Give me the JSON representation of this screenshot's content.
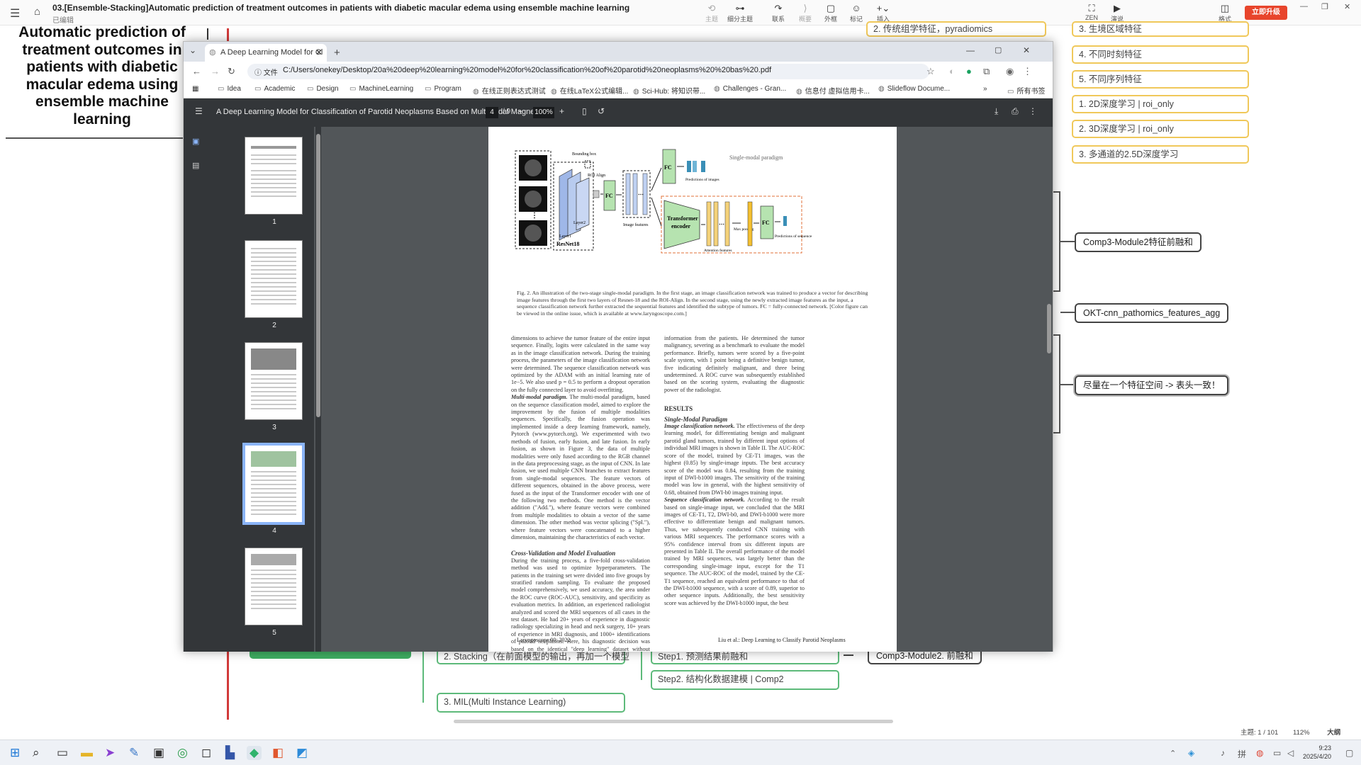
{
  "app": {
    "title": "03.[Ensemble-Stacking]Automatic prediction of treatment outcomes in patients with diabetic macular edema using ensemble machine learning",
    "subtitle": "已编辑",
    "tools": [
      {
        "icon": "theme-icon",
        "label": "主题",
        "dim": true
      },
      {
        "icon": "subtopic-icon",
        "label": "细分主题",
        "dim": false
      },
      {
        "icon": "relation-icon",
        "label": "联系",
        "dim": false
      },
      {
        "icon": "summary-icon",
        "label": "概要",
        "dim": true
      },
      {
        "icon": "boundary-icon",
        "label": "外框",
        "dim": false
      },
      {
        "icon": "marker-icon",
        "label": "标记",
        "dim": false
      },
      {
        "icon": "insert-icon",
        "label": "插入",
        "dim": false
      }
    ],
    "zen_label": "ZEN",
    "present_label": "演说",
    "format_label": "格式",
    "upgrade_label": "立即升级"
  },
  "mindmap": {
    "central_topic": "Automatic prediction of treatment outcomes in patients with diabetic macular edema using ensemble machine learning",
    "right_nodes_yellow": [
      "2. 传统组学特征，pyradiomics",
      "3. 生境区域特征",
      "4. 不同时刻特征",
      "5. 不同序列特征",
      "1. 2D深度学习 | roi_only",
      "2. 3D深度学习 | roi_only",
      "3. 多通道的2.5D深度学习"
    ],
    "right_nodes_dark": [
      "Comp3-Module2特征前融和",
      "OKT-cnn_pathomics_features_agg",
      "尽量在一个特征空间 -> 表头一致！"
    ],
    "bottom_nodes": [
      "2. Stacking（在前面模型的输出，再加一个模型",
      "3. MIL(Multi Instance Learning)",
      "Step1. 预测结果前融和",
      "Step2. 结构化数据建模 | Comp2",
      "Comp3-Module2. 前融和"
    ]
  },
  "browser": {
    "tab_title": "A Deep Learning Model for Cl",
    "url_info": "文件",
    "url": "C:/Users/onekey/Desktop/20a%20deep%20learning%20model%20for%20classification%20of%20parotid%20neoplasms%20%20bas%20.pdf",
    "bookmarks": [
      "Idea",
      "Academic",
      "Design",
      "MachineLearning",
      "Program",
      "在线正则表达式测试",
      "在线LaTeX公式编辑...",
      "Sci-Hub: 将知识带...",
      "Challenges - Gran...",
      "信息付 虚拟信用卡...",
      "Slideflow Docume..."
    ],
    "bookmarks_more": "»",
    "all_bookmarks": "所有书签"
  },
  "pdf": {
    "title": "A Deep Learning Model for Classification of Parotid Neoplasms Based on Multimodal Magne...",
    "current_page": "4",
    "total_pages": "/ 9",
    "zoom": "100%",
    "thumbnails": [
      "1",
      "2",
      "3",
      "4",
      "5"
    ],
    "selected_thumbnail": 3,
    "figure": {
      "bounding_box": "Bounding box",
      "roi_align": "ROI Align",
      "layer1": "Layer1",
      "layer2": "Layer2",
      "resnet": "ResNet18",
      "fc": "FC",
      "image_features": "Image features",
      "predictions_images": "Predictions of images",
      "single_modal": "Single-modal paradigm",
      "transformer": "Transformer encoder",
      "attention_features": "Attention features",
      "max_pooling": "Max pooling",
      "predictions_sequence": "Predictions of sequence"
    },
    "caption": "Fig. 2. An illustration of the two-stage single-modal paradigm. In the first stage, an image classification network was trained to produce a vector for describing image features through the first two layers of Resnet-18 and the ROI-Align. In the second stage, using the newly extracted image features as the input, a sequence classification network further extracted the sequential features and identified the subtype of tumors. FC = fully-connected network. [Color figure can be viewed in the online issue, which is available at www.laryngoscope.com.]",
    "left_col_1": "dimensions to achieve the tumor feature of the entire input sequence. Finally, logits were calculated in the same way as in the image classification network. During the training process, the parameters of the image classification network were determined. The sequence classification network was optimized by the ADAM with an initial learning rate of 1e−5. We also used p = 0.5 to perform a dropout operation on the fully connected layer to avoid overfitting.",
    "multi_modal_heading": "Multi-modal paradigm.",
    "left_col_2": " The multi-modal paradigm, based on the sequence classification model, aimed to explore the improvement by the fusion of multiple modalities sequences. Specifically, the fusion operation was implemented inside a deep learning framework, namely, Pytorch (www.pytorch.org). We experimented with two methods of fusion, early fusion, and late fusion. In early fusion, as shown in Figure 3, the data of multiple modalities were only fused according to the RGB channel in the data preprocessing stage, as the input of CNN. In late fusion, we used multiple CNN branches to extract features from single-modal sequences. The feature vectors of different sequences, obtained in the above process, were fused as the input of the Transformer encoder with one of the following two methods. One method is the vector addition (\"Add.\"), where feature vectors were combined from multiple modalities to obtain a vector of the same dimension. The other method was vector splicing (\"Spl.\"), where feature vectors were concatenated to a higher dimension, maintaining the characteristics of each vector.",
    "cv_heading": "Cross-Validation and Model Evaluation",
    "left_col_3": "During the training process, a five-fold cross-validation method was used to optimize hyperparameters. The patients in the training set were divided into five groups by stratified random sampling. To evaluate the proposed model comprehensively, we used accuracy, the area under the ROC curve (ROC-AUC), sensitivity, and specificity as evaluation metrics. In addition, an experienced radiologist analyzed and scored the MRI sequences of all cases in the test dataset. He had 20+ years of experience in diagnostic radiology specializing in head and neck surgery, 10+ years of experience in MRI diagnosis, and 1000+ identifications of parotid neoplasms. Here, his diagnostic decision was based on the identical \"deep learning\" dataset without additional clinical",
    "right_col_1": "information from the patients. He determined the tumor malignancy, severing as a benchmark to evaluate the model performance. Briefly, tumors were scored by a five-point scale system, with 1 point being a definitive benign tumor, five indicating definitely malignant, and three being undetermined. A ROC curve was subsequently established based on the scoring system, evaluating the diagnostic power of the radiologist.",
    "results_heading": "RESULTS",
    "single_modal_heading": "Single-Modal Paradigm",
    "image_class_heading": "Image classification network.",
    "right_col_2": " The effectiveness of the deep learning model, for differentiating benign and malignant parotid gland tumors, trained by different input options of individual MRI images is shown in Table II. The AUC-ROC score of the model, trained by CE-T1 images, was the highest (0.85) by single-image inputs. The best accuracy score of the model was 0.84, resulting from the training input of DWI-b1000 images. The sensitivity of the training model was low in general, with the highest sensitivity of 0.68, obtained from DWI-b0 images training input.",
    "seq_class_heading": "Sequence classification network.",
    "right_col_3": " According to the result based on single-image input, we concluded that the MRI images of CE-T1, T2, DWI-b0, and DWI-b1000 were more effective to differentiate benign and malignant tumors. Thus, we subsequently conducted CNN training with various MRI sequences. The performance scores with a 95% confidence interval from six different inputs are presented in Table II. The overall performance of the model trained by MRI sequences, was largely better than the corresponding single-image input, except for the T1 sequence. The AUC-ROC of the model, trained by the CE-T1 sequence, reached an equivalent performance to that of the DWI-b1000 sequence, with a score of 0.89, superior to other sequence inputs. Additionally, the best sensitivity score was achieved by the DWI-b1000 input, the best",
    "footer_left": "Laryngoscope 00: 2022",
    "footer_right": "Liu et al.: Deep Learning to Classify Parotid Neoplasms"
  },
  "status": {
    "topic_count": "主题: 1 / 101",
    "zoom": "112%",
    "size": "大纲"
  },
  "clock": {
    "time": "9:23",
    "date": "2025/4/20"
  }
}
